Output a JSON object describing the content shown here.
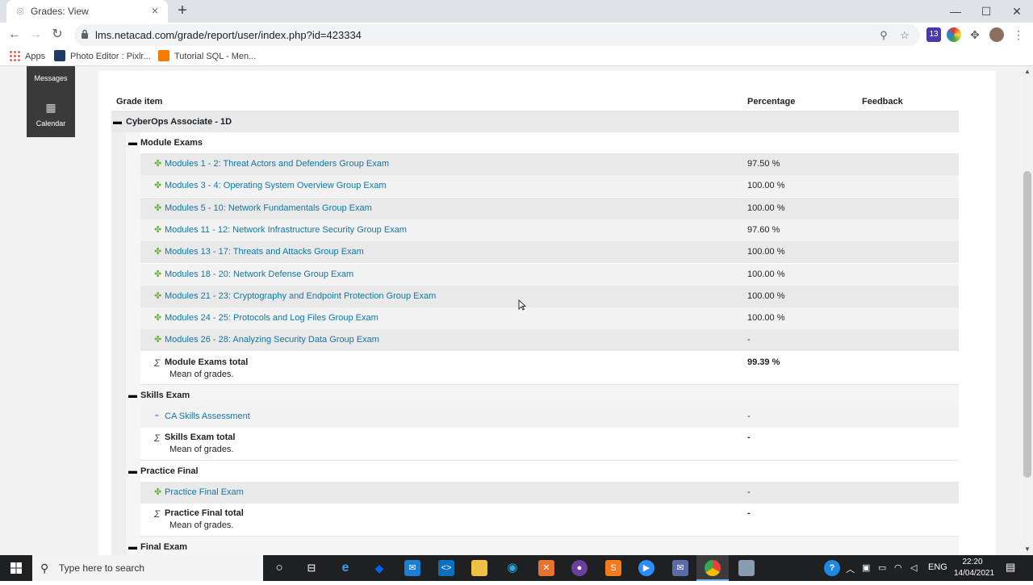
{
  "browser": {
    "tab_title": "Grades: View",
    "url": "lms.netacad.com/grade/report/user/index.php?id=423334",
    "bookmarks": [
      "Apps",
      "Photo Editor : Pixlr...",
      "Tutorial SQL - Men..."
    ],
    "extension_badge": "13"
  },
  "sidebar": {
    "messages_label": "Messages",
    "calendar_label": "Calendar"
  },
  "table": {
    "headers": {
      "grade_item": "Grade item",
      "percentage": "Percentage",
      "feedback": "Feedback"
    },
    "course": "CyberOps Associate - 1D",
    "module_exams": {
      "label": "Module Exams",
      "items": [
        {
          "name": "Modules 1 - 2: Threat Actors and Defenders Group Exam",
          "percentage": "97.50 %"
        },
        {
          "name": "Modules 3 - 4: Operating System Overview Group Exam",
          "percentage": "100.00 %"
        },
        {
          "name": "Modules 5 - 10: Network Fundamentals Group Exam",
          "percentage": "100.00 %"
        },
        {
          "name": "Modules 11 - 12: Network Infrastructure Security Group Exam",
          "percentage": "97.60 %"
        },
        {
          "name": "Modules 13 - 17: Threats and Attacks Group Exam",
          "percentage": "100.00 %"
        },
        {
          "name": "Modules 18 - 20: Network Defense Group Exam",
          "percentage": "100.00 %"
        },
        {
          "name": "Modules 21 - 23: Cryptography and Endpoint Protection Group Exam",
          "percentage": "100.00 %"
        },
        {
          "name": "Modules 24 - 25: Protocols and Log Files Group Exam",
          "percentage": "100.00 %"
        },
        {
          "name": "Modules 26 - 28: Analyzing Security Data Group Exam",
          "percentage": "-"
        }
      ],
      "total_label": "Module Exams total",
      "total_desc": "Mean of grades.",
      "total_percentage": "99.39 %"
    },
    "skills_exam": {
      "label": "Skills Exam",
      "item": {
        "name": "CA Skills Assessment",
        "percentage": "-"
      },
      "total_label": "Skills Exam total",
      "total_desc": "Mean of grades.",
      "total_percentage": "-"
    },
    "practice_final": {
      "label": "Practice Final",
      "item": {
        "name": "Practice Final Exam",
        "percentage": "-"
      },
      "total_label": "Practice Final total",
      "total_desc": "Mean of grades.",
      "total_percentage": "-"
    },
    "final_exam": {
      "label": "Final Exam"
    }
  },
  "taskbar": {
    "search_placeholder": "Type here to search",
    "language": "ENG",
    "time": "22:20",
    "date": "14/04/2021"
  }
}
